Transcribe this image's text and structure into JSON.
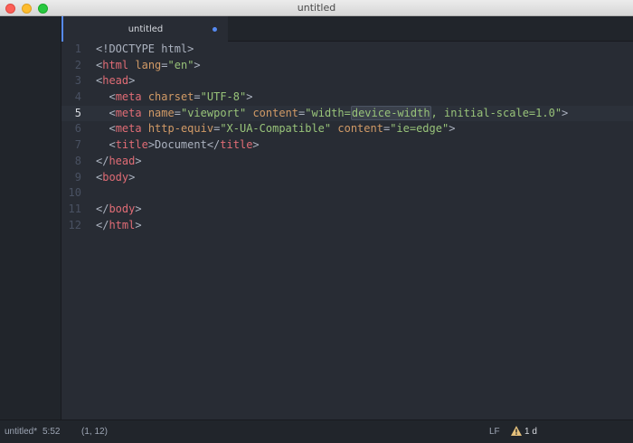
{
  "window": {
    "title": "untitled"
  },
  "tabs": [
    {
      "label": "untitled",
      "modified": true,
      "active": true
    }
  ],
  "editor": {
    "active_line": 5,
    "line_numbers": [
      "1",
      "2",
      "3",
      "4",
      "5",
      "6",
      "7",
      "8",
      "9",
      "10",
      "11",
      "12"
    ],
    "lines": [
      {
        "indent": "",
        "tokens": [
          {
            "t": "tx",
            "v": "<!DOCTYPE html>"
          }
        ]
      },
      {
        "indent": "",
        "tokens": [
          {
            "t": "tx",
            "v": "<"
          },
          {
            "t": "tg",
            "v": "html"
          },
          {
            "t": "tx",
            "v": " "
          },
          {
            "t": "at",
            "v": "lang"
          },
          {
            "t": "tx",
            "v": "="
          },
          {
            "t": "st",
            "v": "\"en\""
          },
          {
            "t": "tx",
            "v": ">"
          }
        ]
      },
      {
        "indent": "",
        "tokens": [
          {
            "t": "tx",
            "v": "<"
          },
          {
            "t": "tg",
            "v": "head"
          },
          {
            "t": "tx",
            "v": ">"
          }
        ]
      },
      {
        "indent": "  ",
        "tokens": [
          {
            "t": "tx",
            "v": "<"
          },
          {
            "t": "tg",
            "v": "meta"
          },
          {
            "t": "tx",
            "v": " "
          },
          {
            "t": "at",
            "v": "charset"
          },
          {
            "t": "tx",
            "v": "="
          },
          {
            "t": "st",
            "v": "\"UTF-8\""
          },
          {
            "t": "tx",
            "v": ">"
          }
        ]
      },
      {
        "indent": "  ",
        "tokens": [
          {
            "t": "tx",
            "v": "<"
          },
          {
            "t": "tg",
            "v": "meta"
          },
          {
            "t": "tx",
            "v": " "
          },
          {
            "t": "at",
            "v": "name"
          },
          {
            "t": "tx",
            "v": "="
          },
          {
            "t": "st",
            "v": "\"viewport\""
          },
          {
            "t": "tx",
            "v": " "
          },
          {
            "t": "at",
            "v": "content"
          },
          {
            "t": "tx",
            "v": "="
          },
          {
            "t": "st",
            "v": "\"width="
          },
          {
            "t": "st hl",
            "v": "device-width"
          },
          {
            "t": "st",
            "v": ", initial-scale=1.0\""
          },
          {
            "t": "tx",
            "v": ">"
          }
        ]
      },
      {
        "indent": "  ",
        "tokens": [
          {
            "t": "tx",
            "v": "<"
          },
          {
            "t": "tg",
            "v": "meta"
          },
          {
            "t": "tx",
            "v": " "
          },
          {
            "t": "at",
            "v": "http-equiv"
          },
          {
            "t": "tx",
            "v": "="
          },
          {
            "t": "st",
            "v": "\"X-UA-Compatible\""
          },
          {
            "t": "tx",
            "v": " "
          },
          {
            "t": "at",
            "v": "content"
          },
          {
            "t": "tx",
            "v": "="
          },
          {
            "t": "st",
            "v": "\"ie=edge\""
          },
          {
            "t": "tx",
            "v": ">"
          }
        ]
      },
      {
        "indent": "  ",
        "tokens": [
          {
            "t": "tx",
            "v": "<"
          },
          {
            "t": "tg",
            "v": "title"
          },
          {
            "t": "tx",
            "v": ">Document</"
          },
          {
            "t": "tg",
            "v": "title"
          },
          {
            "t": "tx",
            "v": ">"
          }
        ]
      },
      {
        "indent": "",
        "tokens": [
          {
            "t": "tx",
            "v": "</"
          },
          {
            "t": "tg",
            "v": "head"
          },
          {
            "t": "tx",
            "v": ">"
          }
        ]
      },
      {
        "indent": "",
        "tokens": [
          {
            "t": "tx",
            "v": "<"
          },
          {
            "t": "tg",
            "v": "body"
          },
          {
            "t": "tx",
            "v": ">"
          }
        ]
      },
      {
        "indent": "",
        "tokens": []
      },
      {
        "indent": "",
        "tokens": [
          {
            "t": "tx",
            "v": "</"
          },
          {
            "t": "tg",
            "v": "body"
          },
          {
            "t": "tx",
            "v": ">"
          }
        ]
      },
      {
        "indent": "",
        "tokens": [
          {
            "t": "tx",
            "v": "</"
          },
          {
            "t": "tg",
            "v": "html"
          },
          {
            "t": "tx",
            "v": ">"
          }
        ]
      }
    ]
  },
  "status": {
    "file": "untitled*",
    "time": "5:52",
    "cursor": "(1, 12)",
    "line_ending": "LF",
    "warnings": "1 d",
    "warning_icon": "warning-icon"
  },
  "colors": {
    "accent": "#568af2",
    "tag": "#e06c75",
    "attribute": "#d19a66",
    "string": "#98c379",
    "text": "#abb2bf",
    "warning": "#e5c07b"
  }
}
